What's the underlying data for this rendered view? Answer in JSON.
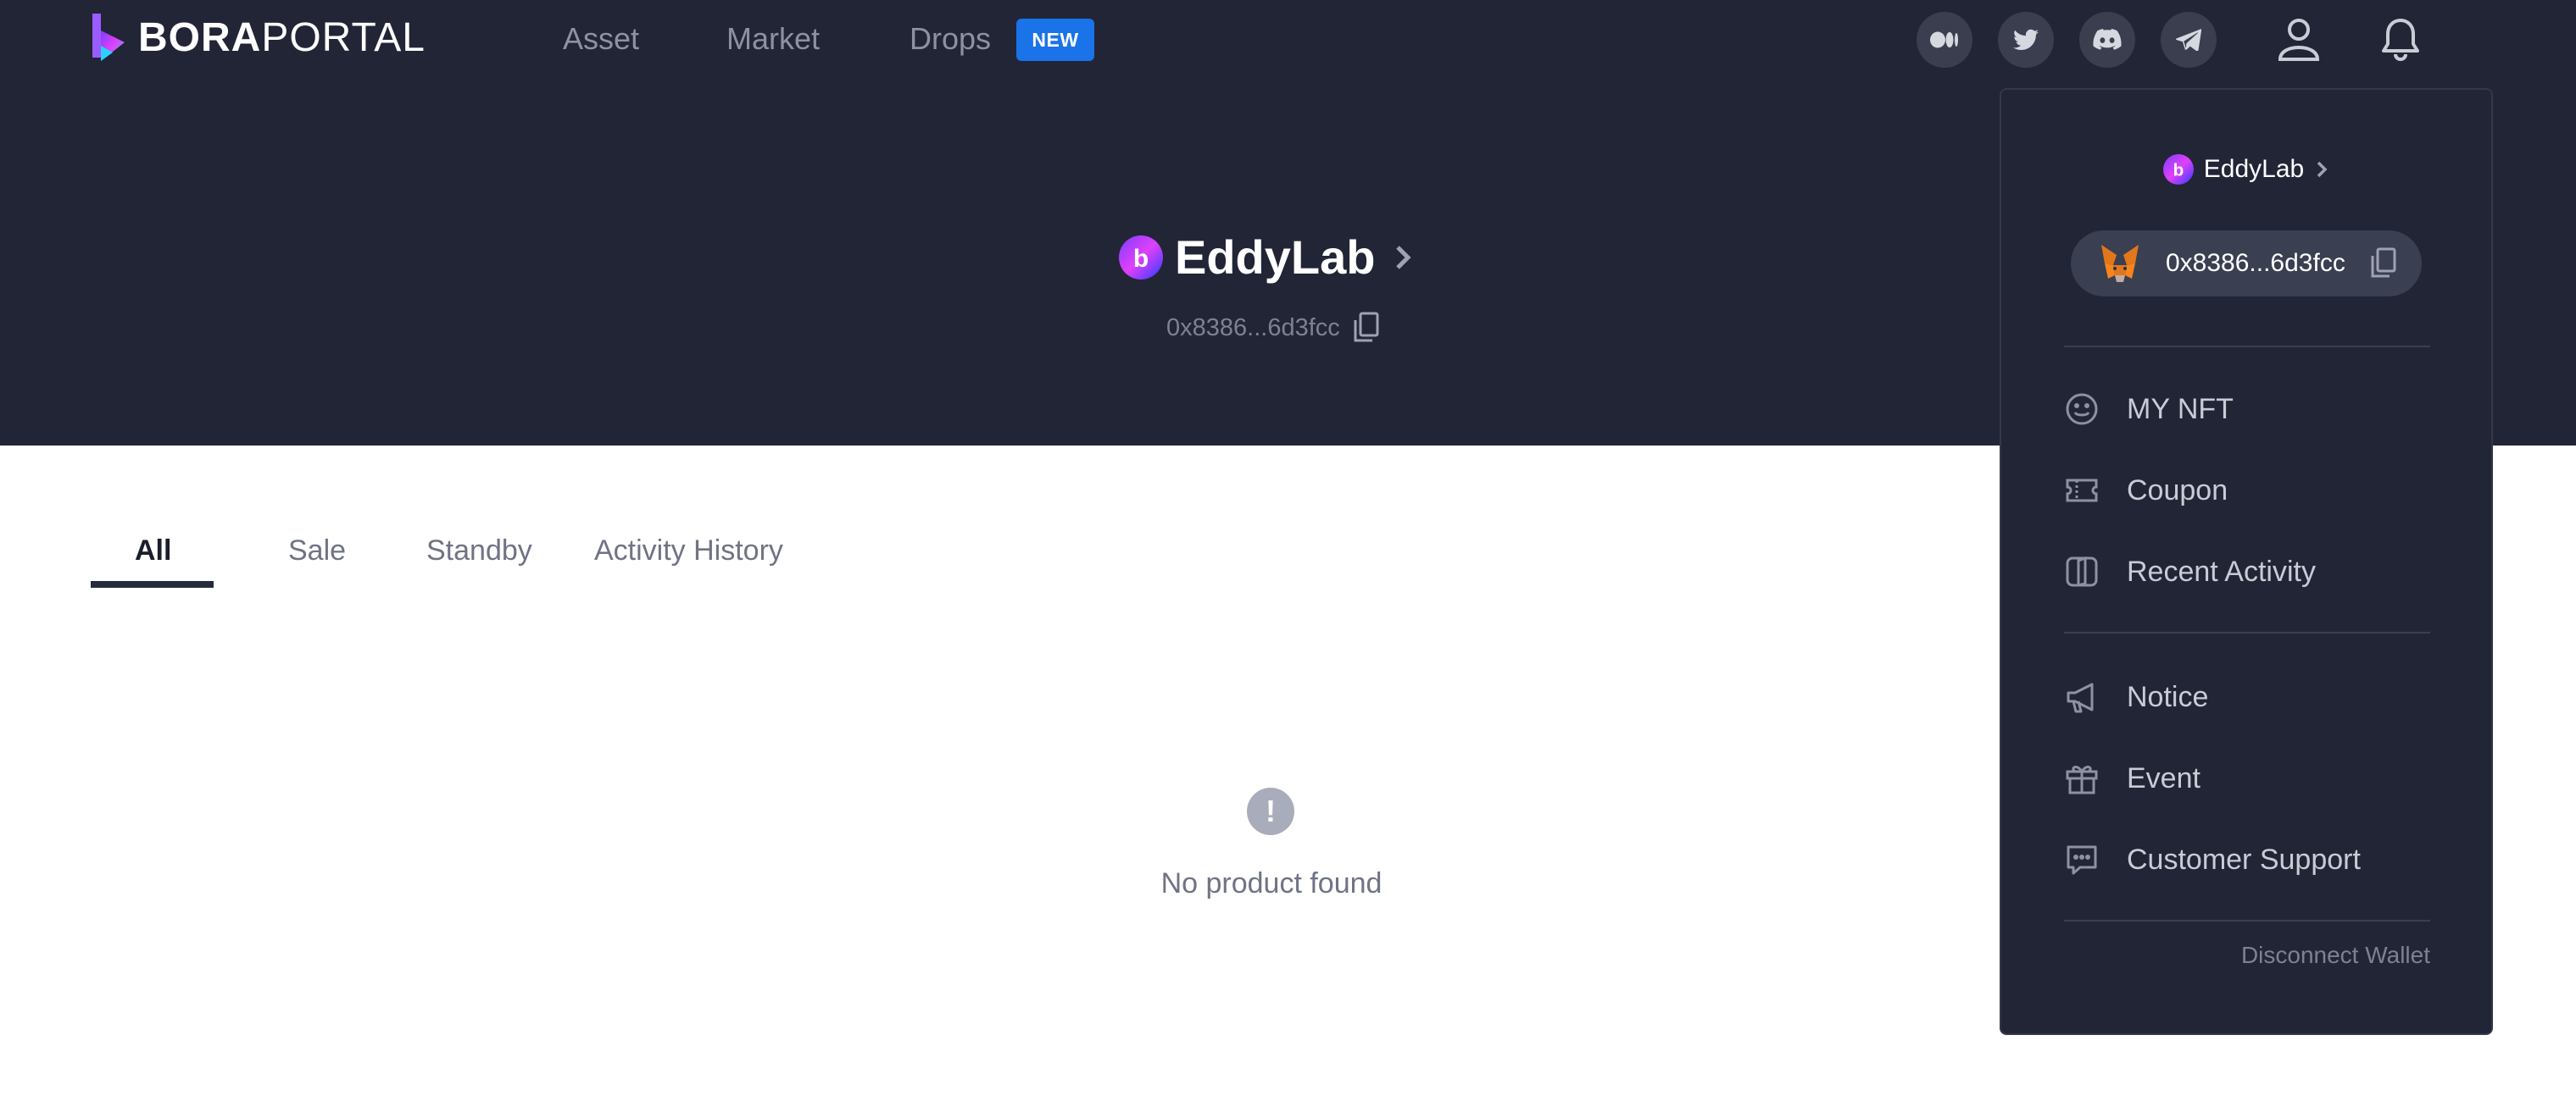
{
  "header": {
    "logo_bold": "BORA",
    "logo_thin": "PORTAL",
    "nav": {
      "asset": "Asset",
      "market": "Market",
      "drops": "Drops",
      "new_badge": "NEW"
    },
    "social_icons": [
      "medium-icon",
      "twitter-icon",
      "discord-icon",
      "telegram-icon"
    ]
  },
  "profile": {
    "name": "EddyLab",
    "address": "0x8386...6d3fcc"
  },
  "tabs": {
    "all": "All",
    "sale": "Sale",
    "standby": "Standby",
    "activity": "Activity History"
  },
  "empty": {
    "icon": "!",
    "text": "No product found"
  },
  "dropdown": {
    "user_name": "EddyLab",
    "wallet_address": "0x8386...6d3fcc",
    "items": {
      "my_nft": "MY NFT",
      "coupon": "Coupon",
      "recent_activity": "Recent Activity",
      "notice": "Notice",
      "event": "Event",
      "customer_support": "Customer Support"
    },
    "disconnect": "Disconnect Wallet"
  },
  "colors": {
    "header_bg": "#212536",
    "accent_blue": "#1a73e8",
    "tab_active": "#252a3e"
  }
}
